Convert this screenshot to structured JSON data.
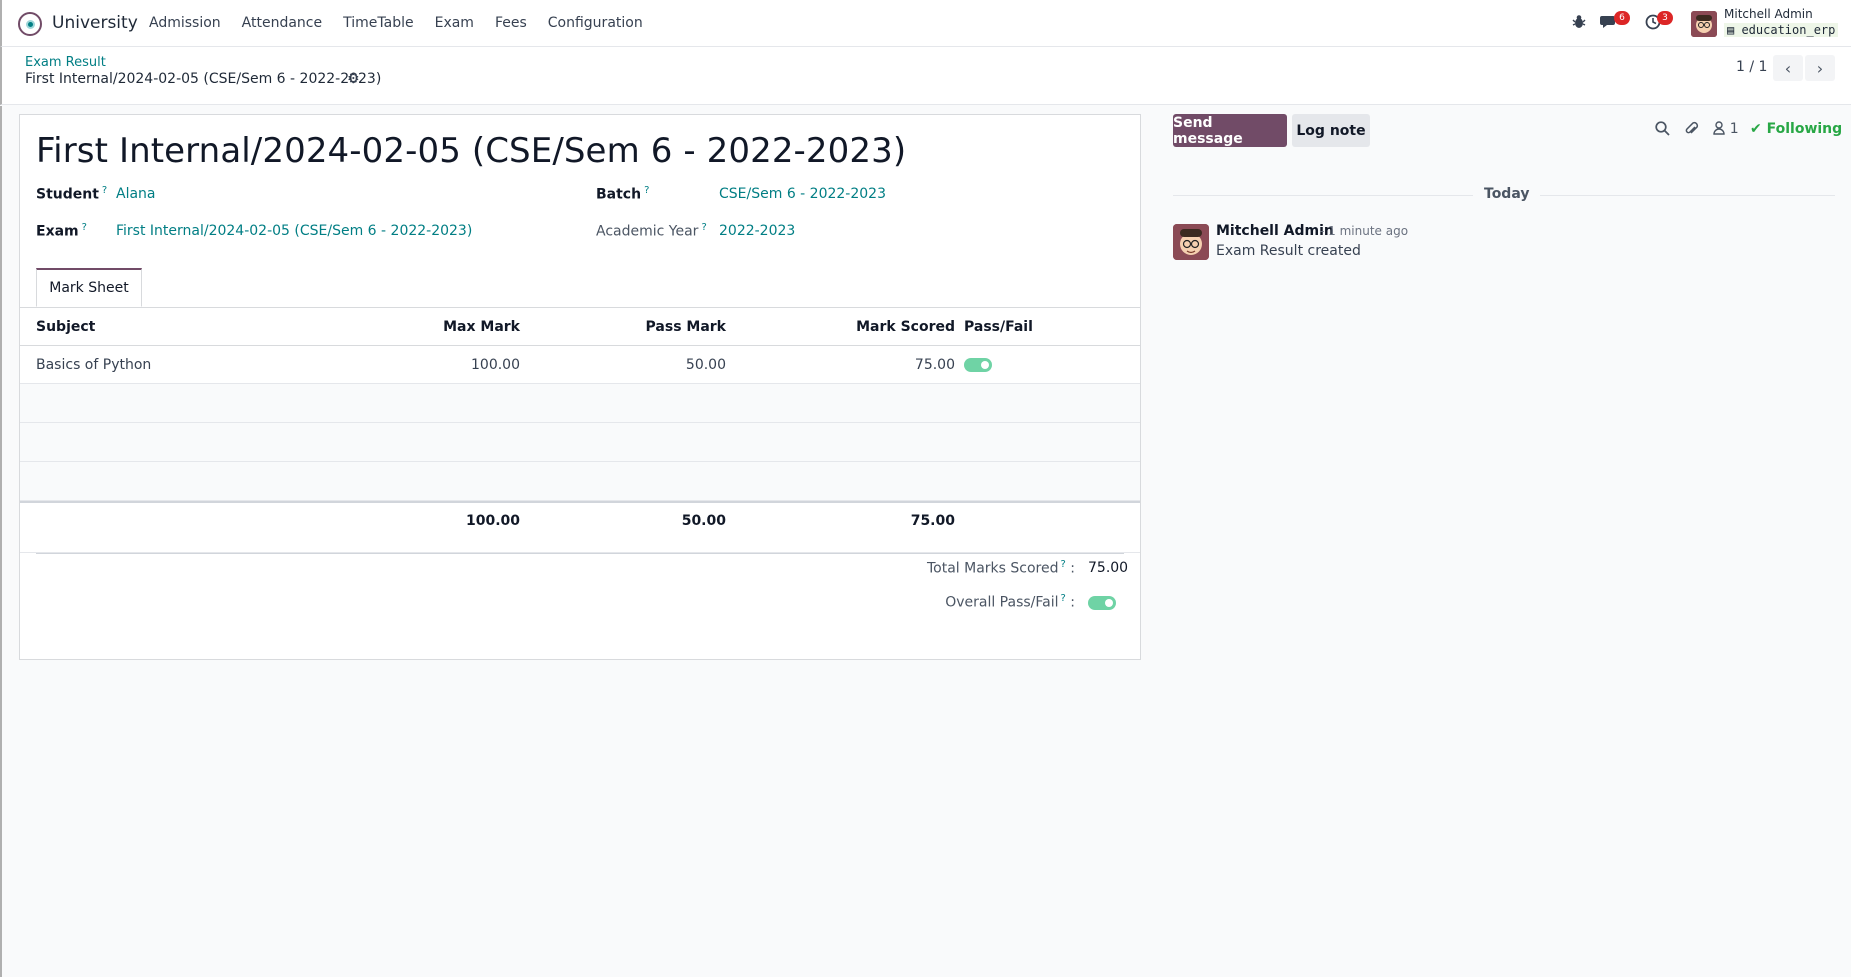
{
  "navbar": {
    "app_name": "University",
    "menu": [
      "Admission",
      "Attendance",
      "TimeTable",
      "Exam",
      "Fees",
      "Configuration"
    ],
    "messages_badge": "6",
    "activities_badge": "3",
    "user_name": "Mitchell Admin",
    "db_name": "education_erp"
  },
  "control": {
    "breadcrumb": "Exam Result",
    "record": "First Internal/2024-02-05 (CSE/Sem 6 - 2022-2023)",
    "pager": "1 / 1"
  },
  "form": {
    "title": "First Internal/2024-02-05 (CSE/Sem 6 - 2022-2023)",
    "student_label": "Student",
    "student": "Alana",
    "exam_label": "Exam",
    "exam": "First Internal/2024-02-05 (CSE/Sem 6 - 2022-2023)",
    "batch_label": "Batch",
    "batch": "CSE/Sem 6 - 2022-2023",
    "year_label": "Academic Year",
    "year": "2022-2023",
    "help_mark": "?"
  },
  "tabs": [
    "Mark Sheet"
  ],
  "table": {
    "headers": [
      "Subject",
      "Max Mark",
      "Pass Mark",
      "Mark Scored",
      "Pass/Fail"
    ],
    "rows": [
      {
        "subject": "Basics of Python",
        "max": "100.00",
        "pass": "50.00",
        "scored": "75.00",
        "passed": true
      }
    ],
    "totals": {
      "max": "100.00",
      "pass": "50.00",
      "scored": "75.00"
    }
  },
  "summary": {
    "total_label": "Total Marks Scored",
    "total_value": "75.00",
    "overall_label": "Overall Pass/Fail",
    "overall_passed": true,
    "colon": ":"
  },
  "chatter": {
    "send_message": "Send message",
    "log_note": "Log note",
    "followers_count": "1",
    "following": "Following",
    "today": "Today",
    "message": {
      "author": "Mitchell Admin",
      "time": "- 1 minute ago",
      "body": "Exam Result created"
    }
  },
  "colors": {
    "brand": "#714b67",
    "link": "#017e84",
    "success": "#28a745",
    "toggle_on": "#6fd3a5",
    "badge": "#dc2626"
  }
}
